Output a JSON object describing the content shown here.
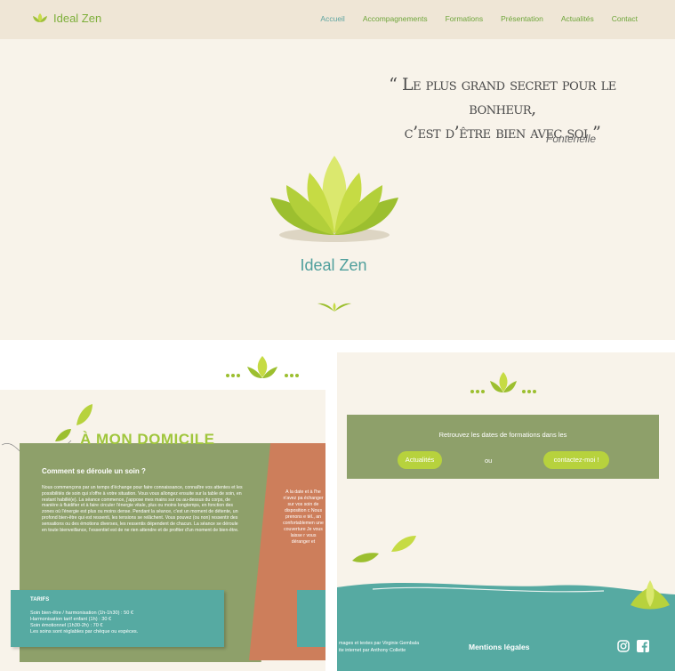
{
  "header": {
    "brand": "Ideal Zen",
    "nav": [
      {
        "label": "Accueil",
        "active": true
      },
      {
        "label": "Accompagnements",
        "active": false
      },
      {
        "label": "Formations",
        "active": false
      },
      {
        "label": "Présentation",
        "active": false
      },
      {
        "label": "Actualités",
        "active": false
      },
      {
        "label": "Contact",
        "active": false
      }
    ]
  },
  "hero": {
    "quote_line1": "“ Le plus grand secret pour le bonheur,",
    "quote_line2": "c’est d’être bien avec soi ”",
    "author": "Fontenelle",
    "brand": "Ideal Zen"
  },
  "domicile": {
    "title": "À MON DOMICILE",
    "question": "Comment se déroule un soin ?",
    "text": "Nous commençons par un temps d'échange pour faire connaissance, connaître vos attentes et les possibilités de soin qui s'offre à votre situation. Vous vous allongez ensuite sur la table de soin, en restant habillé(e). La séance commence, j'appose mes mains sur ou au-dessus du corps, de manière à fluidifier et à faire circuler l'énergie vitale, plus ou moins longtemps, en fonction des zones où l'énergie est plus ou moins dense. Pendant la séance, c'est un moment de détente, un profond bien-être qui est ressenti, les tensions se relâchent. Vous pouvez (ou non) ressentir des sensations ou des émotions diverses, les ressentis dépendent de chacun. La séance se déroule en toute bienveillance, l'essentiel est de ne rien attendre et de profiter d'un moment de bien-être.",
    "side_text": "A la date et à l'he n'avez pa échanger sur vos soin de disposition c Nous prenons e tél., an confortablemen une couverture Je vous laisse r vous déranger et",
    "tarifs": {
      "title": "TARIFS",
      "lines": [
        "Soin bien-être / harmonisation (1h-1h30) : 50 €",
        "Harmonisation tarif enfant (1h) : 30 €",
        "Soin émotionnel (1h30-2h) : 70 €",
        "Les soins sont réglables par chèque ou espèces."
      ]
    }
  },
  "formations": {
    "text": "Retrouvez les dates de formations dans les",
    "btn_actus": "Actualités",
    "ou": "ou",
    "btn_contact": "contactez-moi !"
  },
  "footer": {
    "credits_line1": "mages et textes par Virginie Gembala",
    "credits_line2": "ite internet par Anthony Collette",
    "mentions": "Mentions légales",
    "icons": [
      "instagram-icon",
      "facebook-icon"
    ]
  },
  "colors": {
    "green": "#8ea06a",
    "lime": "#b7d23d",
    "teal": "#56aaa2",
    "terracotta": "#cd7e5b",
    "cream": "#f8f3ea"
  }
}
